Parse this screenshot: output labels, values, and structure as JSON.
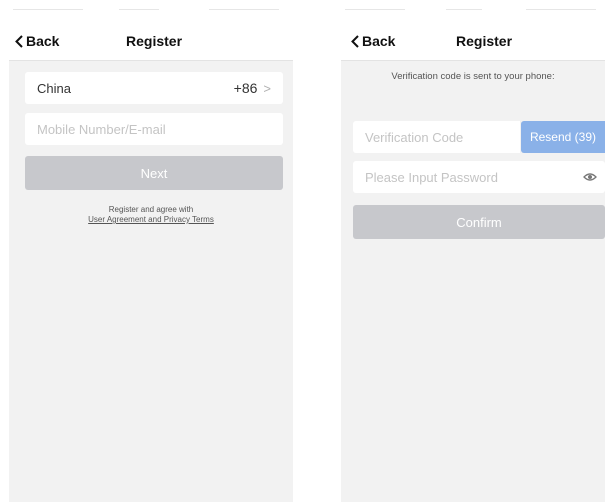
{
  "left_screen": {
    "nav": {
      "back_label": "Back",
      "title": "Register"
    },
    "country": {
      "name": "China",
      "code": "+86",
      "chevron": ">"
    },
    "mobile_input": {
      "placeholder": "Mobile Number/E-mail",
      "value": ""
    },
    "next_button": "Next",
    "agreement": {
      "line1": "Register and agree with",
      "link": "User Agreement and Privacy Terms"
    }
  },
  "right_screen": {
    "nav": {
      "back_label": "Back",
      "title": "Register"
    },
    "info_text": "Verification code is sent to your phone:",
    "code_input": {
      "placeholder": "Verification Code",
      "value": ""
    },
    "resend_button": "Resend (39)",
    "password_input": {
      "placeholder": "Please Input Password",
      "value": ""
    },
    "eye_icon": "eye-icon",
    "confirm_button": "Confirm"
  },
  "colors": {
    "background": "#f2f2f2",
    "button_disabled": "#c7c8cc",
    "button_blue": "#8ab1e8"
  }
}
